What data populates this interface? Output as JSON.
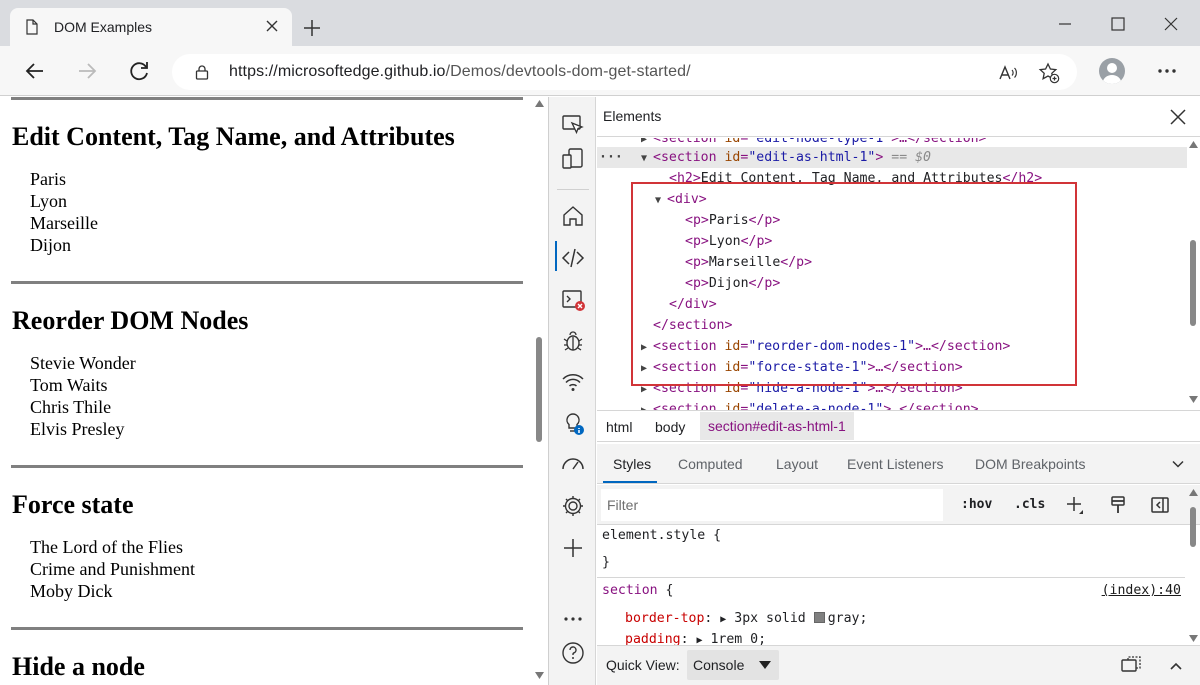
{
  "browser": {
    "tab_title": "DOM Examples",
    "url_host": "https://microsoftedge.github.io",
    "url_path": "/Demos/devtools-dom-get-started/"
  },
  "page": {
    "sections": [
      {
        "heading": "Edit Content, Tag Name, and Attributes",
        "items": [
          "Paris",
          "Lyon",
          "Marseille",
          "Dijon"
        ]
      },
      {
        "heading": "Reorder DOM Nodes",
        "items": [
          "Stevie Wonder",
          "Tom Waits",
          "Chris Thile",
          "Elvis Presley"
        ]
      },
      {
        "heading": "Force state",
        "items": [
          "The Lord of the Flies",
          "Crime and Punishment",
          "Moby Dick"
        ]
      },
      {
        "heading": "Hide a node",
        "items": []
      }
    ]
  },
  "devtools": {
    "panel_title": "Elements",
    "tree": {
      "selected_id": "edit-as-html-1",
      "selected_marker": "== $0",
      "h2_text": "Edit Content, Tag Name, and Attributes",
      "cities": [
        "Paris",
        "Lyon",
        "Marseille",
        "Dijon"
      ],
      "sibling_ids": [
        "reorder-dom-nodes-1",
        "force-state-1",
        "hide-a-node-1",
        "delete-a-node-1"
      ]
    },
    "breadcrumbs": [
      "html",
      "body",
      "section#edit-as-html-1"
    ],
    "styles_tabs": [
      "Styles",
      "Computed",
      "Layout",
      "Event Listeners",
      "DOM Breakpoints"
    ],
    "filter_placeholder": "Filter",
    "hov_label": ":hov",
    "cls_label": ".cls",
    "rules": {
      "element_style": "element.style {",
      "close_brace": "}",
      "section_selector": "section",
      "section_source": "(index):40",
      "border_top_prop": "border-top",
      "border_top_value": "3px solid",
      "border_top_color": "gray",
      "padding_prop": "padding",
      "padding_value": "1rem 0;"
    },
    "quick_view_label": "Quick View:",
    "quick_view_value": "Console"
  },
  "colors": {
    "highlight": "#d13438",
    "accent": "#0067c0",
    "tag": "#881280",
    "attr_name": "#994500",
    "attr_value": "#1a1aa6"
  }
}
